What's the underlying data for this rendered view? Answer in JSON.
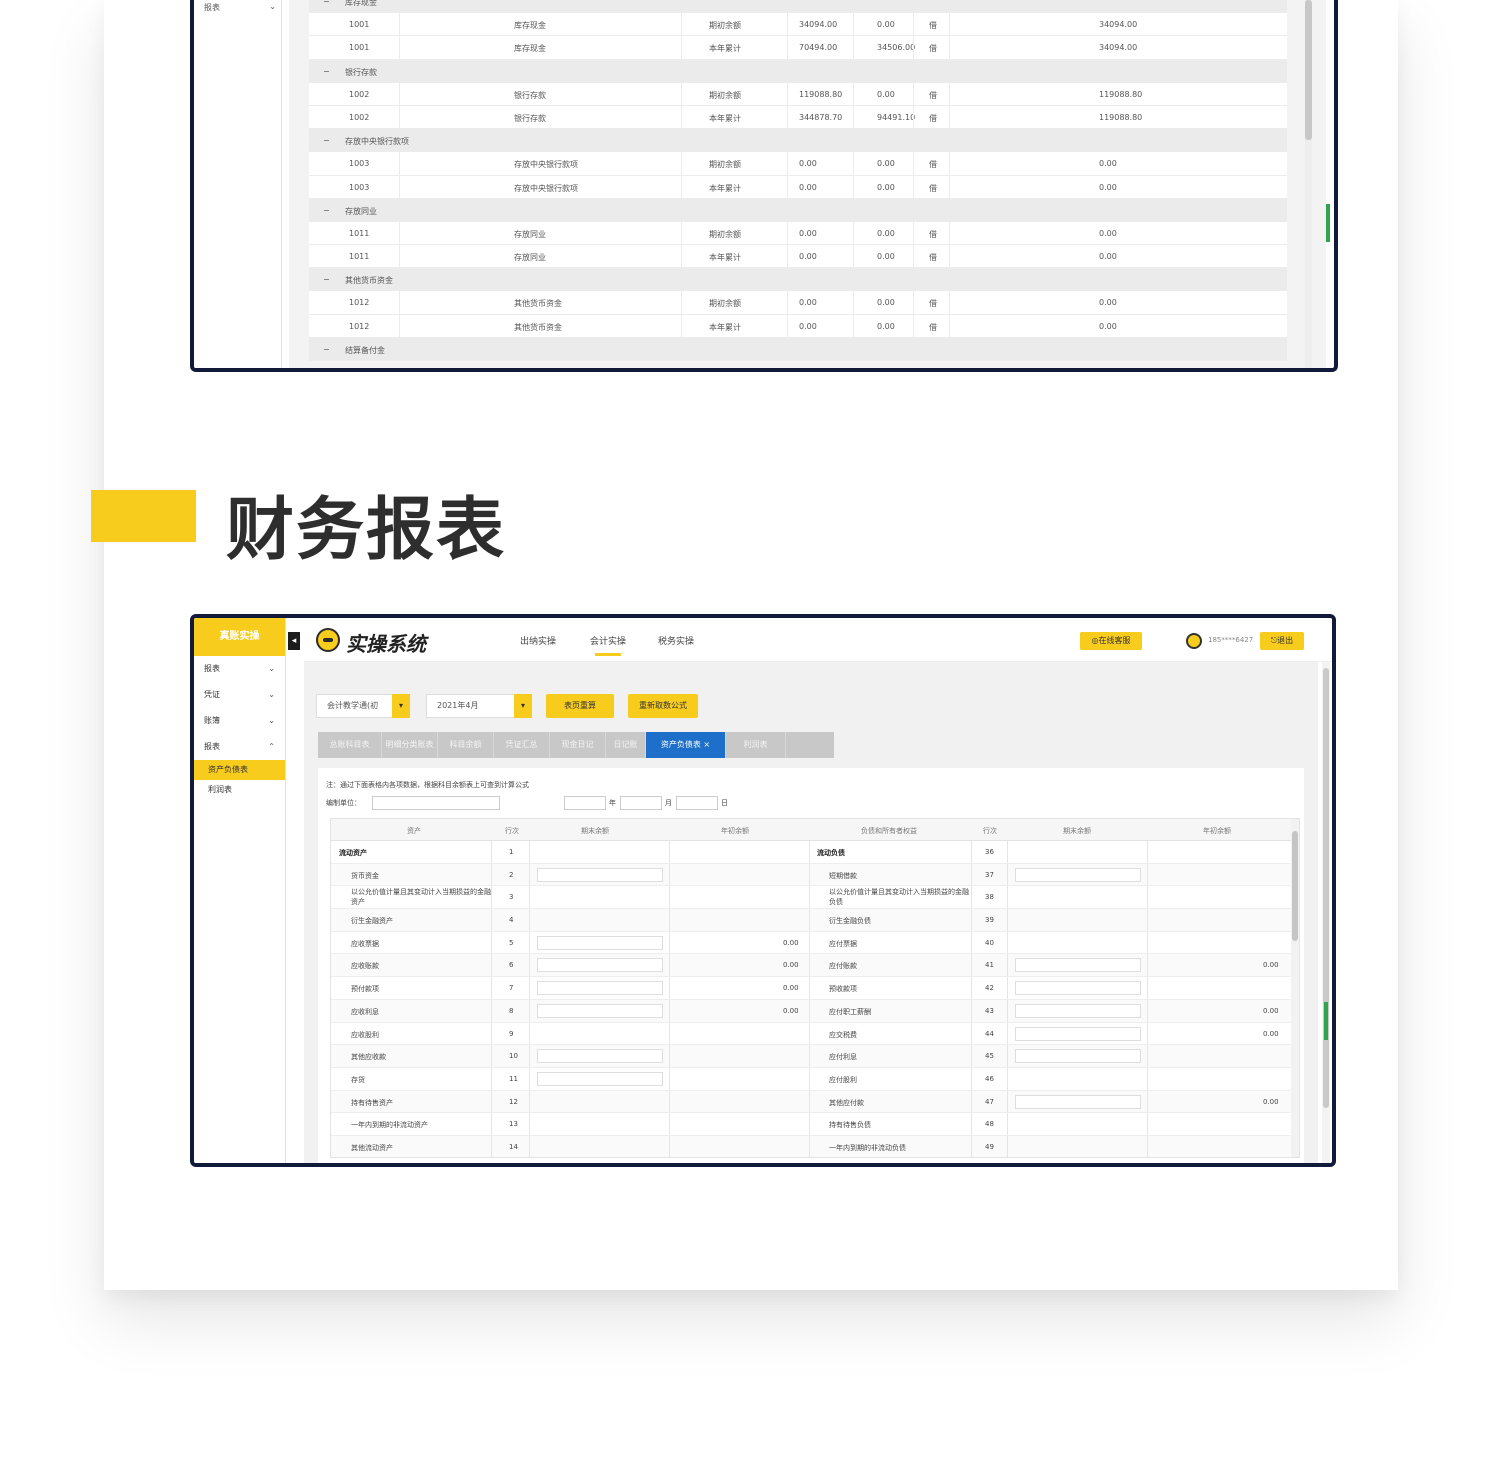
{
  "section": {
    "title": "财务报表"
  },
  "frame1": {
    "sidebar": {
      "menu_label": "报表",
      "menu_chevron": "chevron-down-icon"
    },
    "rows": [
      {
        "type": "group",
        "name": "库存现金"
      },
      {
        "type": "row",
        "code": "1001",
        "name": "库存现金",
        "kind": "期初余额",
        "debit": "34094.00",
        "credit": "0.00",
        "dir": "借",
        "balance": "34094.00"
      },
      {
        "type": "row",
        "code": "1001",
        "name": "库存现金",
        "kind": "本年累计",
        "debit": "70494.00",
        "credit": "34506.00",
        "dir": "借",
        "balance": "34094.00"
      },
      {
        "type": "group",
        "name": "银行存款"
      },
      {
        "type": "row",
        "code": "1002",
        "name": "银行存款",
        "kind": "期初余额",
        "debit": "119088.80",
        "credit": "0.00",
        "dir": "借",
        "balance": "119088.80"
      },
      {
        "type": "row",
        "code": "1002",
        "name": "银行存款",
        "kind": "本年累计",
        "debit": "344878.70",
        "credit": "94491.10",
        "dir": "借",
        "balance": "119088.80"
      },
      {
        "type": "group",
        "name": "存放中央银行款项"
      },
      {
        "type": "row",
        "code": "1003",
        "name": "存放中央银行款项",
        "kind": "期初余额",
        "debit": "0.00",
        "credit": "0.00",
        "dir": "借",
        "balance": "0.00"
      },
      {
        "type": "row",
        "code": "1003",
        "name": "存放中央银行款项",
        "kind": "本年累计",
        "debit": "0.00",
        "credit": "0.00",
        "dir": "借",
        "balance": "0.00"
      },
      {
        "type": "group",
        "name": "存放同业"
      },
      {
        "type": "row",
        "code": "1011",
        "name": "存放同业",
        "kind": "期初余额",
        "debit": "0.00",
        "credit": "0.00",
        "dir": "借",
        "balance": "0.00"
      },
      {
        "type": "row",
        "code": "1011",
        "name": "存放同业",
        "kind": "本年累计",
        "debit": "0.00",
        "credit": "0.00",
        "dir": "借",
        "balance": "0.00"
      },
      {
        "type": "group",
        "name": "其他货币资金"
      },
      {
        "type": "row",
        "code": "1012",
        "name": "其他货币资金",
        "kind": "期初余额",
        "debit": "0.00",
        "credit": "0.00",
        "dir": "借",
        "balance": "0.00"
      },
      {
        "type": "row",
        "code": "1012",
        "name": "其他货币资金",
        "kind": "本年累计",
        "debit": "0.00",
        "credit": "0.00",
        "dir": "借",
        "balance": "0.00"
      },
      {
        "type": "group",
        "name": "结算备付金"
      }
    ]
  },
  "frame2": {
    "sidebar": {
      "header": "真账实操",
      "collapse_icon": "chevron-left-icon",
      "menus": [
        "报表",
        "凭证",
        "账簿",
        "报表"
      ],
      "submenu": [
        "资产负债表",
        "利润表"
      ]
    },
    "topbar": {
      "logo_text": "实操系统",
      "nav": [
        "出纳实操",
        "会计实操",
        "税务实操"
      ],
      "service_button": "在线客服",
      "user": "185****6427",
      "logout_button": "退出"
    },
    "toolbar": {
      "company_select": "会计教学通(初",
      "period_select": "2021年4月",
      "btn_refresh": "表页重算",
      "btn_reset": "重新取数公式"
    },
    "tabs": [
      "总账科目表",
      "明细分类账表",
      "科目余额",
      "凭证汇总",
      "现金日记",
      "日记账",
      "资产负债表 ×",
      "利润表"
    ],
    "sheet": {
      "note": "注：通过下面表格内各项数据，根据科目余额表上可查到计算公式",
      "unit_label": "编制单位：",
      "year_sep": "年",
      "month_sep": "月",
      "day_sep": "日",
      "headers": [
        "资产",
        "行次",
        "期末余额",
        "年初余额",
        "负债和所有者权益",
        "行次",
        "期末余额",
        "年初余额"
      ],
      "rows": [
        {
          "asset": "流动资产",
          "ano": "1",
          "liab": "流动负债",
          "lno": "36",
          "bold": true
        },
        {
          "asset": "货币资金",
          "ano": "2",
          "liab": "短期借款",
          "lno": "37",
          "ai": true,
          "li": true
        },
        {
          "asset": "以公允价值计量且其变动计入当期损益的金融资产",
          "ano": "3",
          "liab": "以公允价值计量且其变动计入当期损益的金融负债",
          "lno": "38"
        },
        {
          "asset": "衍生金融资产",
          "ano": "4",
          "liab": "衍生金融负债",
          "lno": "39"
        },
        {
          "asset": "应收票据",
          "ano": "5",
          "aval": "0.00",
          "liab": "应付票据",
          "lno": "40",
          "ai": true
        },
        {
          "asset": "应收账款",
          "ano": "6",
          "aval": "0.00",
          "liab": "应付账款",
          "lno": "41",
          "lval": "0.00",
          "ai": true,
          "li": true
        },
        {
          "asset": "预付款项",
          "ano": "7",
          "aval": "0.00",
          "liab": "预收款项",
          "lno": "42",
          "ai": true,
          "li": true
        },
        {
          "asset": "应收利息",
          "ano": "8",
          "aval": "0.00",
          "liab": "应付职工薪酬",
          "lno": "43",
          "lval": "0.00",
          "ai": true,
          "li": true
        },
        {
          "asset": "应收股利",
          "ano": "9",
          "liab": "应交税费",
          "lno": "44",
          "lval": "0.00",
          "li": true
        },
        {
          "asset": "其他应收款",
          "ano": "10",
          "liab": "应付利息",
          "lno": "45",
          "ai": true,
          "li": true
        },
        {
          "asset": "存货",
          "ano": "11",
          "liab": "应付股利",
          "lno": "46",
          "ai": true
        },
        {
          "asset": "持有待售资产",
          "ano": "12",
          "liab": "其他应付款",
          "lno": "47",
          "lval": "0.00",
          "li": true
        },
        {
          "asset": "一年内到期的非流动资产",
          "ano": "13",
          "liab": "持有待售负债",
          "lno": "48"
        },
        {
          "asset": "其他流动资产",
          "ano": "14",
          "liab": "一年内到期的非流动负债",
          "lno": "49"
        }
      ]
    }
  }
}
